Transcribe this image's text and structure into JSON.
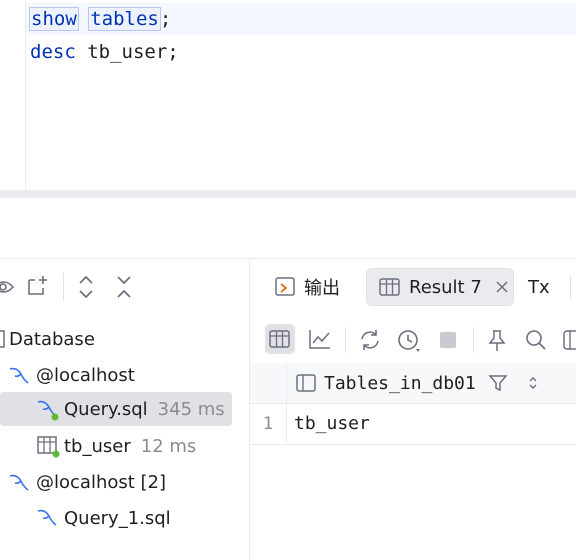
{
  "editor": {
    "line1": {
      "keyword1": "show",
      "keyword2": "tables",
      "suffix": ";"
    },
    "line2": {
      "keyword": "desc",
      "rest": " tb_user;"
    }
  },
  "services_tree": {
    "items": [
      {
        "label": "Database",
        "time": ""
      },
      {
        "label": "@localhost",
        "time": ""
      },
      {
        "label": "Query.sql",
        "time": "345 ms"
      },
      {
        "label": "tb_user",
        "time": "12 ms"
      },
      {
        "label": "@localhost [2]",
        "time": ""
      },
      {
        "label": "Query_1.sql",
        "time": ""
      }
    ]
  },
  "tabs": {
    "output": "输出",
    "result": "Result 7",
    "tx": "Tx"
  },
  "grid": {
    "column": "Tables_in_db01",
    "rows": [
      {
        "num": "1",
        "value": "tb_user"
      }
    ]
  },
  "colors": {
    "keyword": "#0033b3",
    "selection": "#dfe1e5",
    "mysql_icon": "#3574f0",
    "ok_dot": "#5fb832",
    "output_icon_accent": "#e66d17"
  }
}
